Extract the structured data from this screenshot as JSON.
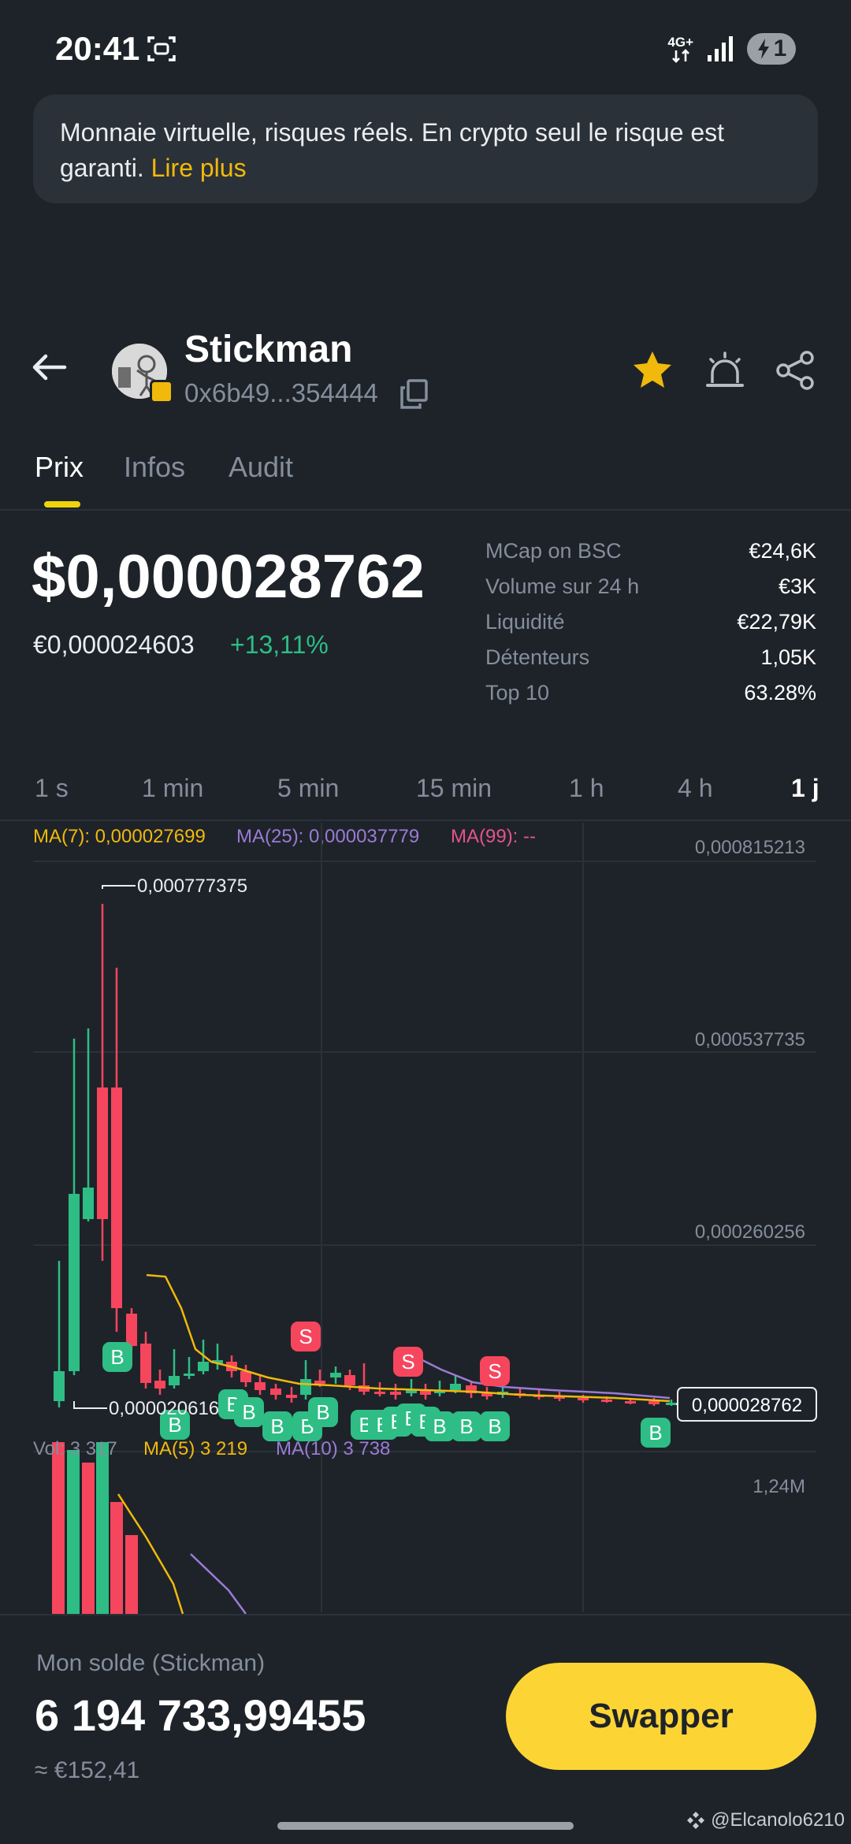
{
  "status_bar": {
    "time": "20:41",
    "network_label_top": "4G+",
    "battery_level": "1",
    "icons": [
      "screen-capture-icon",
      "data-arrows-icon",
      "signal-icon",
      "battery-charging-icon"
    ]
  },
  "banner": {
    "text": "Monnaie virtuelle, risques réels. En crypto seul le risque est garanti.",
    "link": "Lire plus"
  },
  "token": {
    "name": "Stickman",
    "address": "0x6b49...354444",
    "icons": [
      "back-arrow-icon",
      "copy-icon",
      "star-icon",
      "alert-icon",
      "share-icon"
    ]
  },
  "tabs": [
    {
      "label": "Prix",
      "active": true
    },
    {
      "label": "Infos",
      "active": false
    },
    {
      "label": "Audit",
      "active": false
    }
  ],
  "price": {
    "usd": "$0,000028762",
    "eur": "€0,000024603",
    "change": "+13,11%"
  },
  "stats": [
    {
      "label": "MCap on BSC",
      "value": "€24,6K"
    },
    {
      "label": "Volume sur 24 h",
      "value": "€3K"
    },
    {
      "label": "Liquidité",
      "value": "€22,79K"
    },
    {
      "label": "Détenteurs",
      "value": "1,05K"
    },
    {
      "label": "Top 10",
      "value": "63.28%"
    }
  ],
  "intervals": [
    {
      "label": "1 s",
      "active": false
    },
    {
      "label": "1 min",
      "active": false
    },
    {
      "label": "5 min",
      "active": false
    },
    {
      "label": "15 min",
      "active": false
    },
    {
      "label": "1 h",
      "active": false
    },
    {
      "label": "4 h",
      "active": false
    },
    {
      "label": "1 j",
      "active": true
    }
  ],
  "ma_legend": {
    "ma7": "MA(7): 0,000027699",
    "ma25": "MA(25): 0,000037779",
    "ma99": "MA(99): --"
  },
  "colors": {
    "up": "#2ebd85",
    "down": "#f6465d",
    "ma7": "#f0b90b",
    "ma25": "#9b7bd5",
    "ma99": "#e5548a",
    "accent": "#fcd535"
  },
  "chart_data": {
    "type": "candlestick",
    "price_axis_labels": [
      "0,000815213",
      "0,000537735",
      "0,000260256"
    ],
    "high_label": "0,000777375",
    "low_label": "0,000020616",
    "current_price_label": "0,000028762",
    "trade_markers": {
      "buy_label": "B",
      "sell_label": "S",
      "buy_count": 19,
      "sell_count": 3
    },
    "volume": {
      "vol_label": "Vol: 3 317",
      "ma5_label": "MA(5) 3 219",
      "ma10_label": "MA(10) 3 738",
      "axis_label": "1,24M"
    }
  },
  "footer": {
    "balance_label": "Mon solde (Stickman)",
    "balance_value": "6 194 733,99455",
    "balance_eur": "≈ €152,41",
    "swap_label": "Swapper"
  },
  "watermark": {
    "text": "@Elcanolo6210",
    "icon": "binance-logo-icon"
  }
}
